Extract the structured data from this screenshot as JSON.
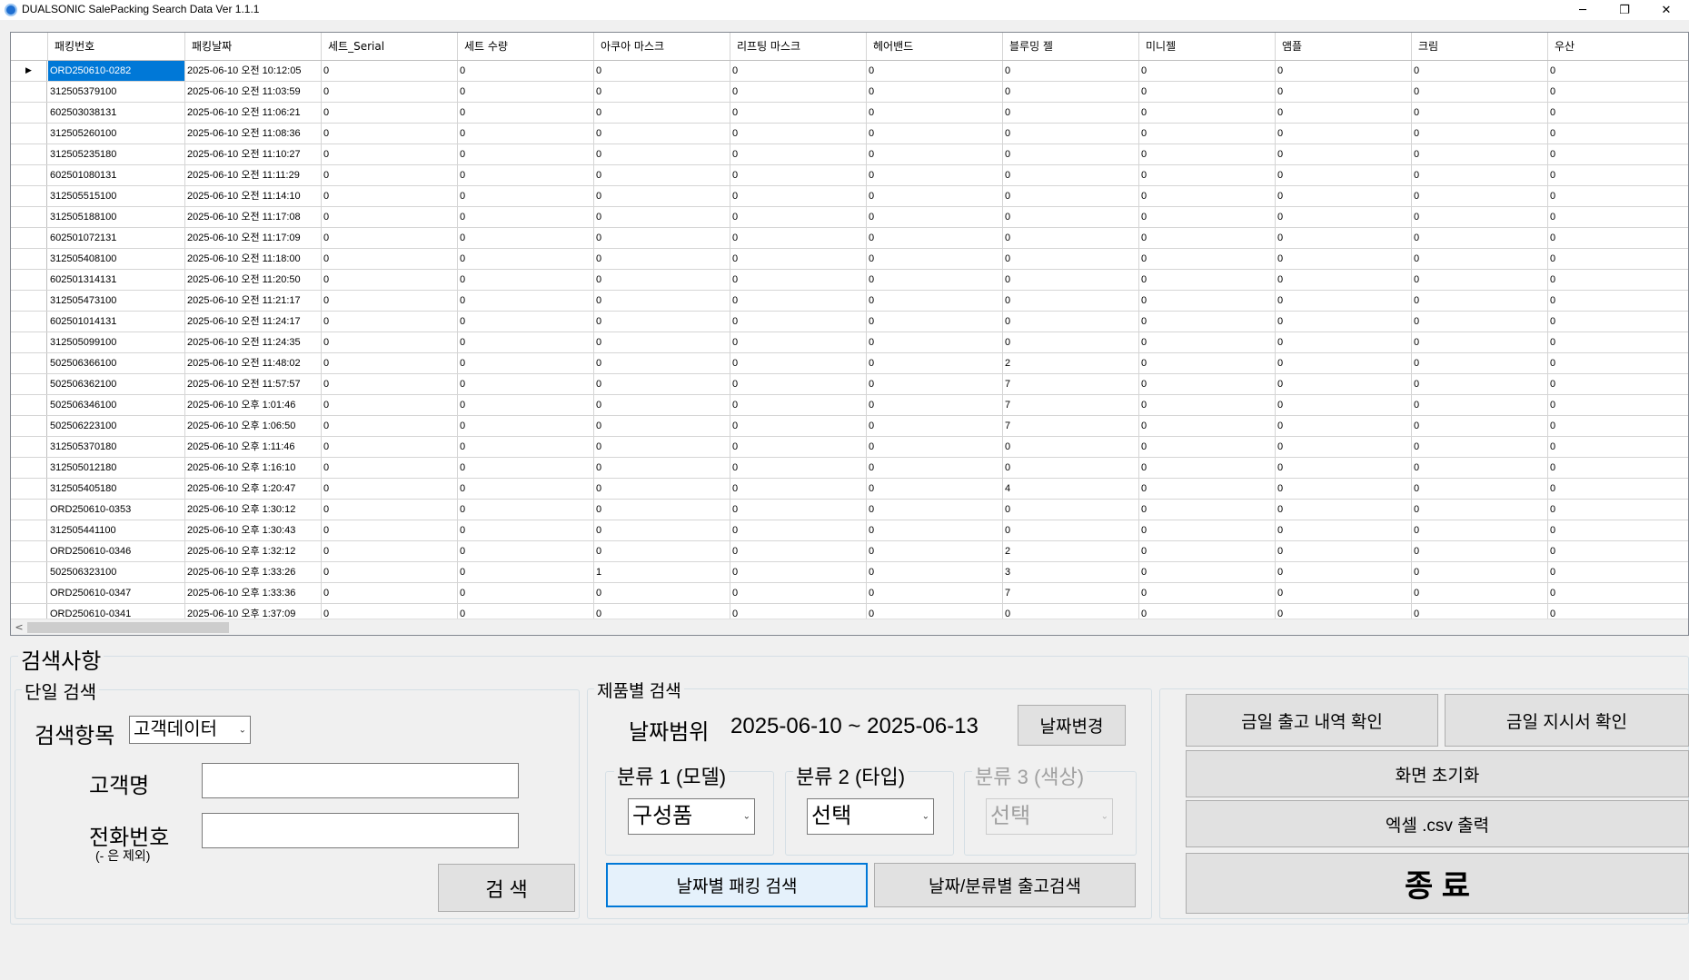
{
  "window": {
    "title": "DUALSONIC SalePacking Search Data Ver 1.1.1",
    "min": "─",
    "max": "❐",
    "close": "✕"
  },
  "grid": {
    "columns": [
      "패킹번호",
      "패킹날짜",
      "세트_Serial",
      "세트 수량",
      "아쿠아 마스크",
      "리프팅 마스크",
      "헤어밴드",
      "블루밍 젤",
      "미니젤",
      "앰플",
      "크림",
      "우산"
    ],
    "current_row_marker": "▶",
    "rows": [
      [
        "ORD250610-0282",
        "2025-06-10 오전 10:12:05",
        "0",
        "0",
        "0",
        "0",
        "0",
        "0",
        "0",
        "0",
        "0",
        "0"
      ],
      [
        "312505379100",
        "2025-06-10 오전 11:03:59",
        "0",
        "0",
        "0",
        "0",
        "0",
        "0",
        "0",
        "0",
        "0",
        "0"
      ],
      [
        "602503038131",
        "2025-06-10 오전 11:06:21",
        "0",
        "0",
        "0",
        "0",
        "0",
        "0",
        "0",
        "0",
        "0",
        "0"
      ],
      [
        "312505260100",
        "2025-06-10 오전 11:08:36",
        "0",
        "0",
        "0",
        "0",
        "0",
        "0",
        "0",
        "0",
        "0",
        "0"
      ],
      [
        "312505235180",
        "2025-06-10 오전 11:10:27",
        "0",
        "0",
        "0",
        "0",
        "0",
        "0",
        "0",
        "0",
        "0",
        "0"
      ],
      [
        "602501080131",
        "2025-06-10 오전 11:11:29",
        "0",
        "0",
        "0",
        "0",
        "0",
        "0",
        "0",
        "0",
        "0",
        "0"
      ],
      [
        "312505515100",
        "2025-06-10 오전 11:14:10",
        "0",
        "0",
        "0",
        "0",
        "0",
        "0",
        "0",
        "0",
        "0",
        "0"
      ],
      [
        "312505188100",
        "2025-06-10 오전 11:17:08",
        "0",
        "0",
        "0",
        "0",
        "0",
        "0",
        "0",
        "0",
        "0",
        "0"
      ],
      [
        "602501072131",
        "2025-06-10 오전 11:17:09",
        "0",
        "0",
        "0",
        "0",
        "0",
        "0",
        "0",
        "0",
        "0",
        "0"
      ],
      [
        "312505408100",
        "2025-06-10 오전 11:18:00",
        "0",
        "0",
        "0",
        "0",
        "0",
        "0",
        "0",
        "0",
        "0",
        "0"
      ],
      [
        "602501314131",
        "2025-06-10 오전 11:20:50",
        "0",
        "0",
        "0",
        "0",
        "0",
        "0",
        "0",
        "0",
        "0",
        "0"
      ],
      [
        "312505473100",
        "2025-06-10 오전 11:21:17",
        "0",
        "0",
        "0",
        "0",
        "0",
        "0",
        "0",
        "0",
        "0",
        "0"
      ],
      [
        "602501014131",
        "2025-06-10 오전 11:24:17",
        "0",
        "0",
        "0",
        "0",
        "0",
        "0",
        "0",
        "0",
        "0",
        "0"
      ],
      [
        "312505099100",
        "2025-06-10 오전 11:24:35",
        "0",
        "0",
        "0",
        "0",
        "0",
        "0",
        "0",
        "0",
        "0",
        "0"
      ],
      [
        "502506366100",
        "2025-06-10 오전 11:48:02",
        "0",
        "0",
        "0",
        "0",
        "0",
        "2",
        "0",
        "0",
        "0",
        "0"
      ],
      [
        "502506362100",
        "2025-06-10 오전 11:57:57",
        "0",
        "0",
        "0",
        "0",
        "0",
        "7",
        "0",
        "0",
        "0",
        "0"
      ],
      [
        "502506346100",
        "2025-06-10 오후 1:01:46",
        "0",
        "0",
        "0",
        "0",
        "0",
        "7",
        "0",
        "0",
        "0",
        "0"
      ],
      [
        "502506223100",
        "2025-06-10 오후 1:06:50",
        "0",
        "0",
        "0",
        "0",
        "0",
        "7",
        "0",
        "0",
        "0",
        "0"
      ],
      [
        "312505370180",
        "2025-06-10 오후 1:11:46",
        "0",
        "0",
        "0",
        "0",
        "0",
        "0",
        "0",
        "0",
        "0",
        "0"
      ],
      [
        "312505012180",
        "2025-06-10 오후 1:16:10",
        "0",
        "0",
        "0",
        "0",
        "0",
        "0",
        "0",
        "0",
        "0",
        "0"
      ],
      [
        "312505405180",
        "2025-06-10 오후 1:20:47",
        "0",
        "0",
        "0",
        "0",
        "0",
        "4",
        "0",
        "0",
        "0",
        "0"
      ],
      [
        "ORD250610-0353",
        "2025-06-10 오후 1:30:12",
        "0",
        "0",
        "0",
        "0",
        "0",
        "0",
        "0",
        "0",
        "0",
        "0"
      ],
      [
        "312505441100",
        "2025-06-10 오후 1:30:43",
        "0",
        "0",
        "0",
        "0",
        "0",
        "0",
        "0",
        "0",
        "0",
        "0"
      ],
      [
        "ORD250610-0346",
        "2025-06-10 오후 1:32:12",
        "0",
        "0",
        "0",
        "0",
        "0",
        "2",
        "0",
        "0",
        "0",
        "0"
      ],
      [
        "502506323100",
        "2025-06-10 오후 1:33:26",
        "0",
        "0",
        "1",
        "0",
        "0",
        "3",
        "0",
        "0",
        "0",
        "0"
      ],
      [
        "ORD250610-0347",
        "2025-06-10 오후 1:33:36",
        "0",
        "0",
        "0",
        "0",
        "0",
        "7",
        "0",
        "0",
        "0",
        "0"
      ],
      [
        "ORD250610-0341",
        "2025-06-10 오후 1:37:09",
        "0",
        "0",
        "0",
        "0",
        "0",
        "0",
        "0",
        "0",
        "0",
        "0"
      ]
    ],
    "scroll_left": "<"
  },
  "search": {
    "title": "검색사항",
    "single": {
      "title": "단일 검색",
      "item_label": "검색항목",
      "item_value": "고객데이터",
      "name_label": "고객명",
      "name_value": "",
      "phone_label": "전화번호",
      "phone_note": "(- 은 제외)",
      "phone_value": "",
      "search_button": "검  색"
    },
    "product": {
      "title": "제품별 검색",
      "date_label": "날짜범위",
      "date_range": "2025-06-10  ~  2025-06-13",
      "date_change_button": "날짜변경",
      "cat1_label": "분류 1 (모델)",
      "cat1_value": "구성품",
      "cat2_label": "분류 2 (타입)",
      "cat2_value": "선택",
      "cat3_label": "분류 3 (색상)",
      "cat3_value": "선택",
      "packing_search_button": "날짜별 패킹 검색",
      "outbound_search_button": "날짜/분류별 출고검색"
    },
    "actions": {
      "today_outbound_button": "금일 출고 내역 확인",
      "today_instruction_button": "금일 지시서 확인",
      "reset_button": "화면 초기화",
      "export_button": "엑셀 .csv 출력",
      "exit_button": "종  료"
    }
  }
}
